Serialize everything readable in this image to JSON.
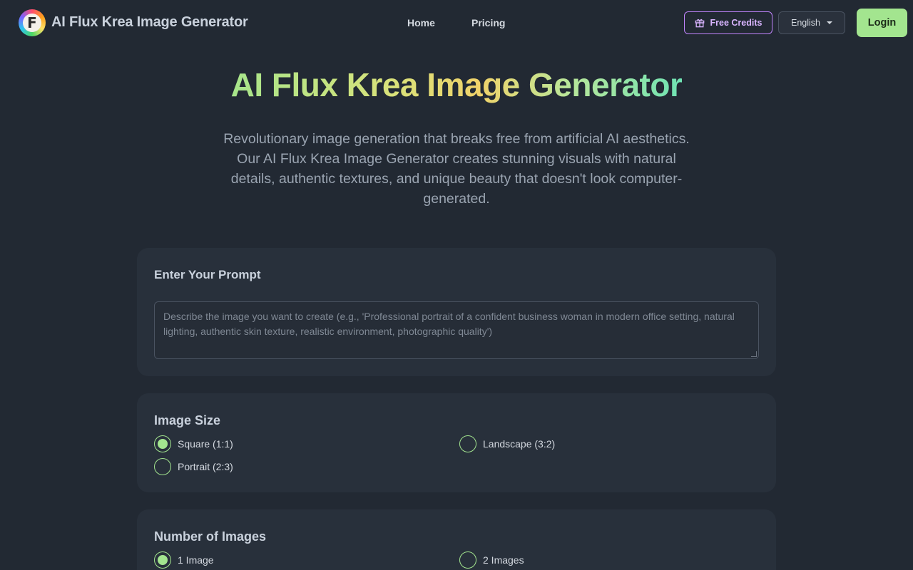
{
  "header": {
    "logo_letter": "F",
    "brand": "AI Flux Krea Image Generator",
    "nav": [
      {
        "label": "Home"
      },
      {
        "label": "Pricing"
      }
    ],
    "free_credits": "Free Credits",
    "language": "English",
    "login": "Login"
  },
  "hero": {
    "title": "AI Flux Krea Image Generator",
    "subtitle": "Revolutionary image generation that breaks free from artificial AI aesthetics. Our AI Flux Krea Image Generator creates stunning visuals with natural details, authentic textures, and unique beauty that doesn't look computer-generated."
  },
  "prompt": {
    "title": "Enter Your Prompt",
    "placeholder": "Describe the image you want to create (e.g., 'Professional portrait of a confident business woman in modern office setting, natural lighting, authentic skin texture, realistic environment, photographic quality')"
  },
  "image_size": {
    "title": "Image Size",
    "options": [
      {
        "label": "Square (1:1)",
        "checked": true
      },
      {
        "label": "Landscape (3:2)",
        "checked": false
      },
      {
        "label": "Portrait (2:3)",
        "checked": false
      }
    ]
  },
  "image_count": {
    "title": "Number of Images",
    "options": [
      {
        "label": "1 Image",
        "checked": true
      },
      {
        "label": "2 Images",
        "checked": false
      }
    ]
  },
  "colors": {
    "background": "#222933",
    "card": "#28303b",
    "accent_green": "#a3e58f",
    "accent_purple": "#c084fc"
  }
}
